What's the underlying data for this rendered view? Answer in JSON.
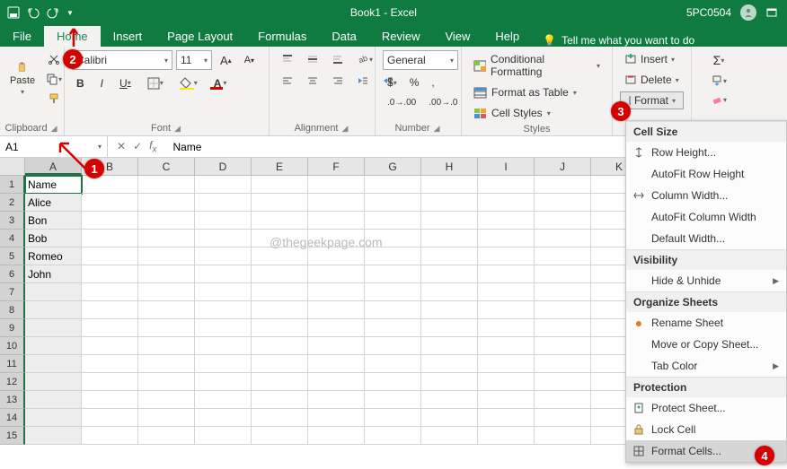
{
  "title": "Book1  -  Excel",
  "user": "5PC0504",
  "tabs": [
    "File",
    "Home",
    "Insert",
    "Page Layout",
    "Formulas",
    "Data",
    "Review",
    "View",
    "Help"
  ],
  "active_tab": "Home",
  "tellme": "Tell me what you want to do",
  "ribbon": {
    "clipboard": {
      "paste": "Paste",
      "label": "Clipboard"
    },
    "font": {
      "name": "Calibri",
      "size": "11",
      "label": "Font"
    },
    "alignment": {
      "label": "Alignment"
    },
    "number": {
      "format": "General",
      "label": "Number"
    },
    "styles": {
      "cond": "Conditional Formatting",
      "table": "Format as Table",
      "cell": "Cell Styles",
      "label": "Styles"
    },
    "cells": {
      "insert": "Insert",
      "delete": "Delete",
      "format": "Format"
    },
    "editing": {
      "label": ""
    }
  },
  "namebox": "A1",
  "formula_value": "Name",
  "columns": [
    "A",
    "B",
    "C",
    "D",
    "E",
    "F",
    "G",
    "H",
    "I",
    "J",
    "K"
  ],
  "selected_col": "A",
  "cell_data": {
    "1": "Name",
    "2": "Alice",
    "3": "Bon",
    "4": "Bob",
    "5": "Romeo",
    "6": "John"
  },
  "row_count": 15,
  "watermark": "@thegeekpage.com",
  "menu": {
    "sections": [
      {
        "title": "Cell Size",
        "items": [
          {
            "label": "Row Height...",
            "icon": "row-height"
          },
          {
            "label": "AutoFit Row Height"
          },
          {
            "label": "Column Width...",
            "icon": "col-width"
          },
          {
            "label": "AutoFit Column Width"
          },
          {
            "label": "Default Width..."
          }
        ]
      },
      {
        "title": "Visibility",
        "items": [
          {
            "label": "Hide & Unhide",
            "sub": true
          }
        ]
      },
      {
        "title": "Organize Sheets",
        "items": [
          {
            "label": "Rename Sheet",
            "dot": true
          },
          {
            "label": "Move or Copy Sheet..."
          },
          {
            "label": "Tab Color",
            "sub": true
          }
        ]
      },
      {
        "title": "Protection",
        "items": [
          {
            "label": "Protect Sheet...",
            "icon": "protect"
          },
          {
            "label": "Lock Cell",
            "icon": "lock"
          },
          {
            "label": "Format Cells...",
            "icon": "format-cells",
            "hl": true
          }
        ]
      }
    ]
  },
  "badges": {
    "1": "1",
    "2": "2",
    "3": "3",
    "4": "4"
  }
}
